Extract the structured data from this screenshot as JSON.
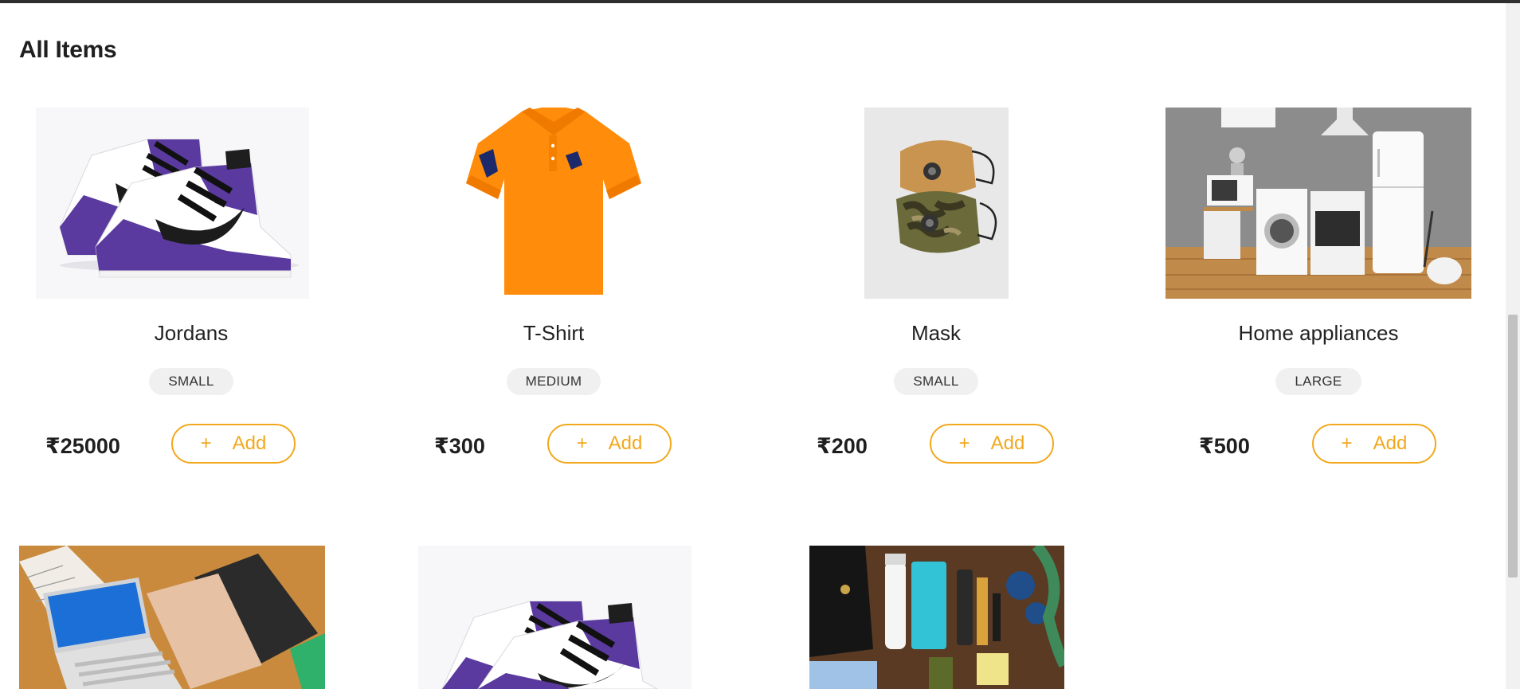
{
  "page": {
    "heading": "All Items"
  },
  "currency_symbol": "₹",
  "products": [
    {
      "name": "Jordans",
      "size": "SMALL",
      "price": "₹25000",
      "add_label": "Add",
      "image": "purple-jordan-sneaker"
    },
    {
      "name": "T-Shirt",
      "size": "MEDIUM",
      "price": "₹300",
      "add_label": "Add",
      "image": "orange-polo-shirt"
    },
    {
      "name": "Mask",
      "size": "SMALL",
      "price": "₹200",
      "add_label": "Add",
      "image": "cloth-face-masks"
    },
    {
      "name": "Home appliances",
      "size": "LARGE",
      "price": "₹500",
      "add_label": "Add",
      "image": "kitchen-appliances"
    },
    {
      "image": "laptops-on-table"
    },
    {
      "image": "purple-jordan-sneaker"
    },
    {
      "image": "cosmetics-flatlay"
    }
  ],
  "colors": {
    "accent": "#f2a81d",
    "badge_bg": "#f0f0f0",
    "text": "#222222",
    "shoe_purple": "#5b3aa0",
    "shirt_orange": "#ff8c0a"
  }
}
